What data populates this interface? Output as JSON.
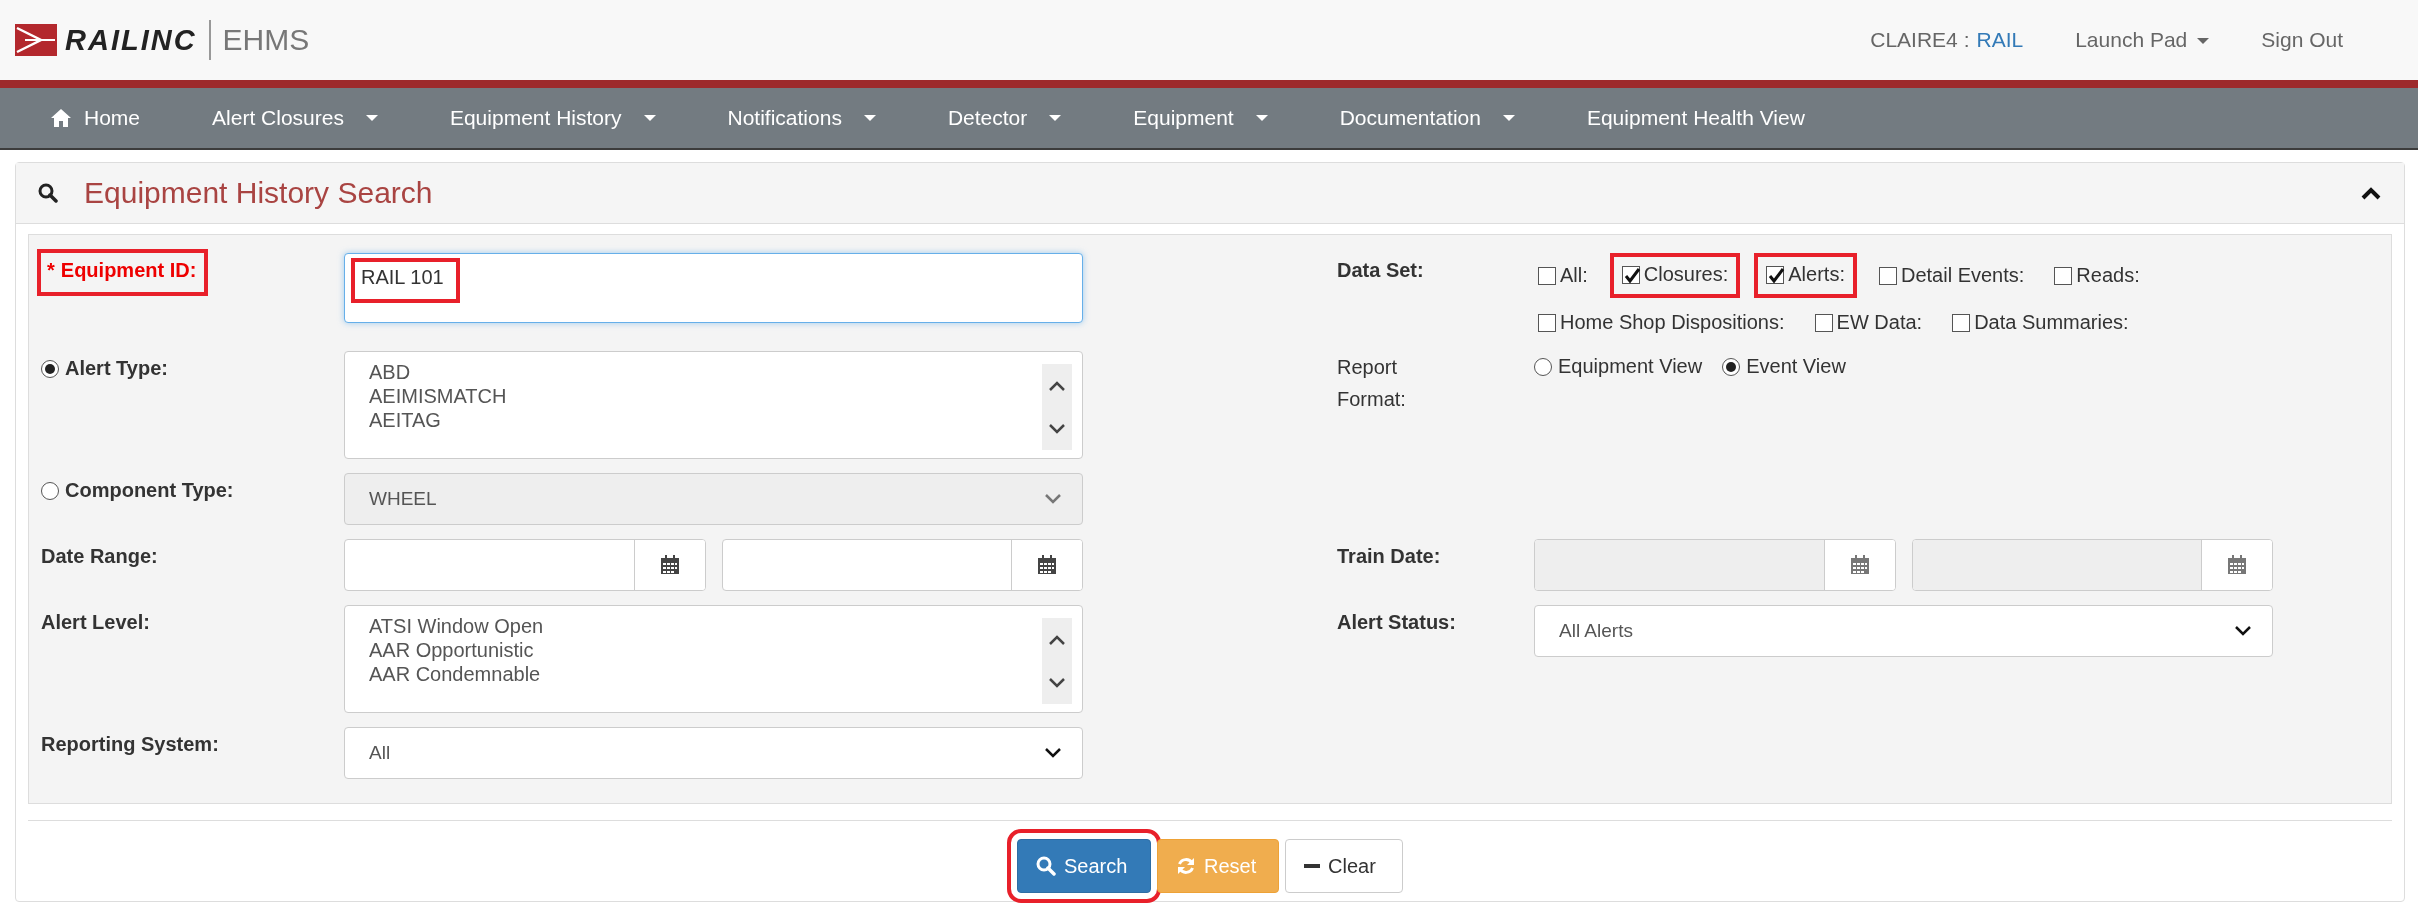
{
  "header": {
    "logo_text": "RAILINC",
    "app_name": "EHMS",
    "user": "CLAIRE4 :",
    "org": "RAIL",
    "launch_pad": "Launch Pad",
    "sign_out": "Sign Out"
  },
  "nav": [
    {
      "kind": "home",
      "label": "Home"
    },
    {
      "kind": "menu",
      "label": "Alert Closures"
    },
    {
      "kind": "menu",
      "label": "Equipment History"
    },
    {
      "kind": "menu",
      "label": "Notifications"
    },
    {
      "kind": "menu",
      "label": "Detector"
    },
    {
      "kind": "menu",
      "label": "Equipment"
    },
    {
      "kind": "menu",
      "label": "Documentation"
    },
    {
      "kind": "link",
      "label": "Equipment Health View"
    }
  ],
  "panel": {
    "title": "Equipment History Search",
    "expanded": true
  },
  "rows": [
    {
      "left": {
        "kind": "text",
        "label": "Equipment ID:",
        "required": true,
        "required_mark": "*",
        "bold_label": true,
        "highlighted": true,
        "value": "RAIL 101",
        "value_highlighted": true
      },
      "right": {
        "kind": "checkboxes",
        "label": "Data Set:",
        "bold_label": true,
        "options": [
          {
            "label": "All:",
            "checked": false,
            "highlighted": false
          },
          {
            "label": "Closures:",
            "checked": true,
            "highlighted": true
          },
          {
            "label": "Alerts:",
            "checked": true,
            "highlighted": true
          },
          {
            "label": "Detail Events:",
            "checked": false,
            "highlighted": false
          },
          {
            "label": "Reads:",
            "checked": false,
            "highlighted": false
          },
          {
            "label": "Home Shop Dispositions:",
            "checked": false,
            "highlighted": false
          },
          {
            "label": "EW Data:",
            "checked": false,
            "highlighted": false
          },
          {
            "label": "Data Summaries:",
            "checked": false,
            "highlighted": false
          }
        ]
      }
    },
    {
      "left": {
        "kind": "listbox",
        "label": "Alert Type:",
        "selected": true,
        "bold_label": true,
        "items": [
          "ABD",
          "AEIMISMATCH",
          "AEITAG"
        ]
      },
      "right": {
        "kind": "radios",
        "label": "Report Format:",
        "bold_label": false,
        "options": [
          {
            "label": "Equipment View",
            "selected": false
          },
          {
            "label": "Event View",
            "selected": true
          }
        ]
      }
    },
    {
      "left": {
        "kind": "select",
        "label": "Component Type:",
        "selected": false,
        "bold_label": true,
        "value": "WHEEL",
        "disabled": true
      }
    },
    {
      "left": {
        "kind": "daterange",
        "label": "Date Range:",
        "bold_label": true,
        "disabled": false
      },
      "right": {
        "kind": "daterange",
        "label": "Train Date:",
        "bold_label": true,
        "disabled": true
      }
    },
    {
      "left": {
        "kind": "listbox",
        "label": "Alert Level:",
        "bold_label": true,
        "items": [
          "ATSI Window Open",
          "AAR Opportunistic",
          "AAR Condemnable"
        ]
      },
      "right": {
        "kind": "select",
        "label": "Alert Status:",
        "bold_label": true,
        "value": "All Alerts",
        "disabled": false
      }
    },
    {
      "left": {
        "kind": "select",
        "label": "Reporting System:",
        "bold_label": true,
        "value": "All",
        "disabled": false
      }
    }
  ],
  "buttons": [
    {
      "kind": "primary",
      "label": "Search",
      "highlighted": true
    },
    {
      "kind": "warning",
      "label": "Reset",
      "highlighted": false
    },
    {
      "kind": "default",
      "label": "Clear",
      "highlighted": false
    }
  ]
}
